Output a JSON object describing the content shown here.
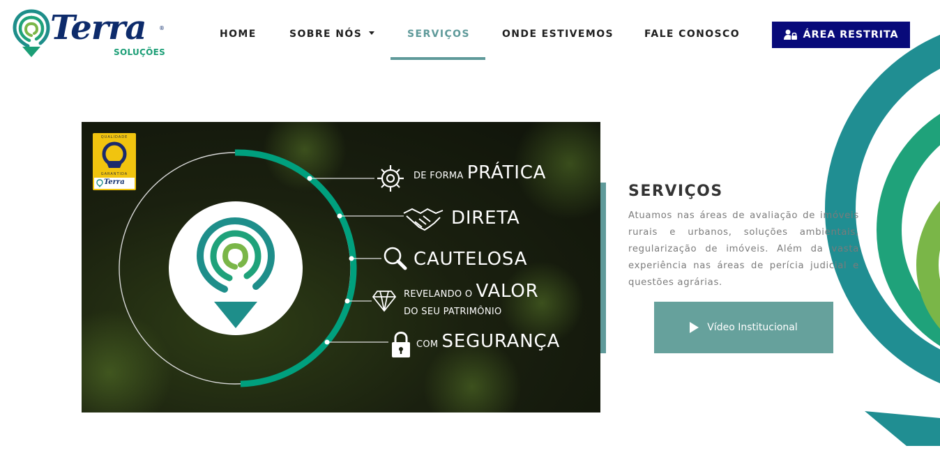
{
  "brand": {
    "name": "Terra",
    "tagline": "SOLUÇÕES",
    "registered": "®",
    "colors": {
      "navy": "#0d2b6b",
      "teal": "#1e8e8a",
      "green": "#1b9e76",
      "lime": "#7ab648"
    }
  },
  "nav": {
    "items": [
      {
        "label": "HOME"
      },
      {
        "label": "SOBRE NÓS",
        "has_dropdown": true
      },
      {
        "label": "SERVIÇOS",
        "active": true
      },
      {
        "label": "ONDE ESTIVEMOS"
      },
      {
        "label": "FALE CONOSCO"
      }
    ],
    "active_color": "#5f9a9a",
    "restricted_button": {
      "label": "ÁREA RESTRITA",
      "icon": "user-lock-icon",
      "color": "#080a7a"
    }
  },
  "banner": {
    "seal": {
      "top_text": "QUALIDADE",
      "mid_text": "GARANTIDA",
      "brand": "Terra"
    },
    "features": [
      {
        "icon": "gear-icon",
        "prefix": "DE FORMA",
        "label": "PRÁTICA"
      },
      {
        "icon": "handshake-icon",
        "prefix": "",
        "label": "DIRETA"
      },
      {
        "icon": "magnifier-icon",
        "prefix": "",
        "label": "CAUTELOSA"
      },
      {
        "icon": "diamond-icon",
        "prefix": "REVELANDO O",
        "label": "VALOR",
        "suffix": "DO SEU PATRIMÔNIO"
      },
      {
        "icon": "padlock-icon",
        "prefix": "COM",
        "label": "SEGURANÇA"
      }
    ]
  },
  "services": {
    "title": "SERVIÇOS",
    "description": "Atuamos nas áreas de avaliação de imóveis rurais e urbanos, soluções ambientais, regularização de imóveis. Além da vasta experiência nas áreas de perícia judicial e questões agrárias.",
    "video_button": {
      "label": "Vídeo Institucional",
      "icon": "play-icon"
    },
    "accent_color": "#5f9a9a"
  }
}
